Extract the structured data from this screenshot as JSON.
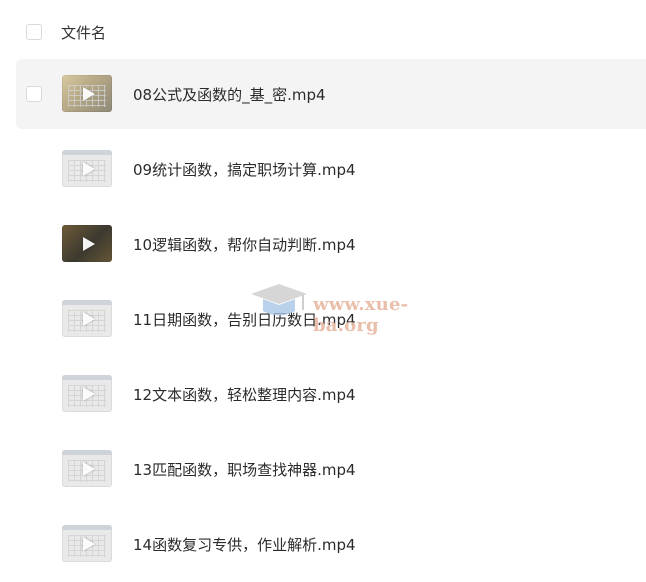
{
  "header": {
    "column_label": "文件名"
  },
  "files": [
    {
      "name": "08公式及函数的_基_密.mp4",
      "thumb": "gold",
      "selected": true
    },
    {
      "name": "09统计函数，搞定职场计算.mp4",
      "thumb": "sheet",
      "selected": false
    },
    {
      "name": "10逻辑函数，帮你自动判断.mp4",
      "thumb": "dark",
      "selected": false
    },
    {
      "name": "11日期函数，告别日历数日.mp4",
      "thumb": "sheet",
      "selected": false
    },
    {
      "name": "12文本函数，轻松整理内容.mp4",
      "thumb": "sheet",
      "selected": false
    },
    {
      "name": "13匹配函数，职场查找神器.mp4",
      "thumb": "sheet",
      "selected": false
    },
    {
      "name": "14函数复习专供，作业解析.mp4",
      "thumb": "sheet",
      "selected": false
    }
  ],
  "watermark": {
    "text": "www.xue-ba.org",
    "icon": "graduation-cap-icon"
  },
  "colors": {
    "row_selected_bg": "#f4f4f5",
    "watermark": "#e7b9a2"
  }
}
